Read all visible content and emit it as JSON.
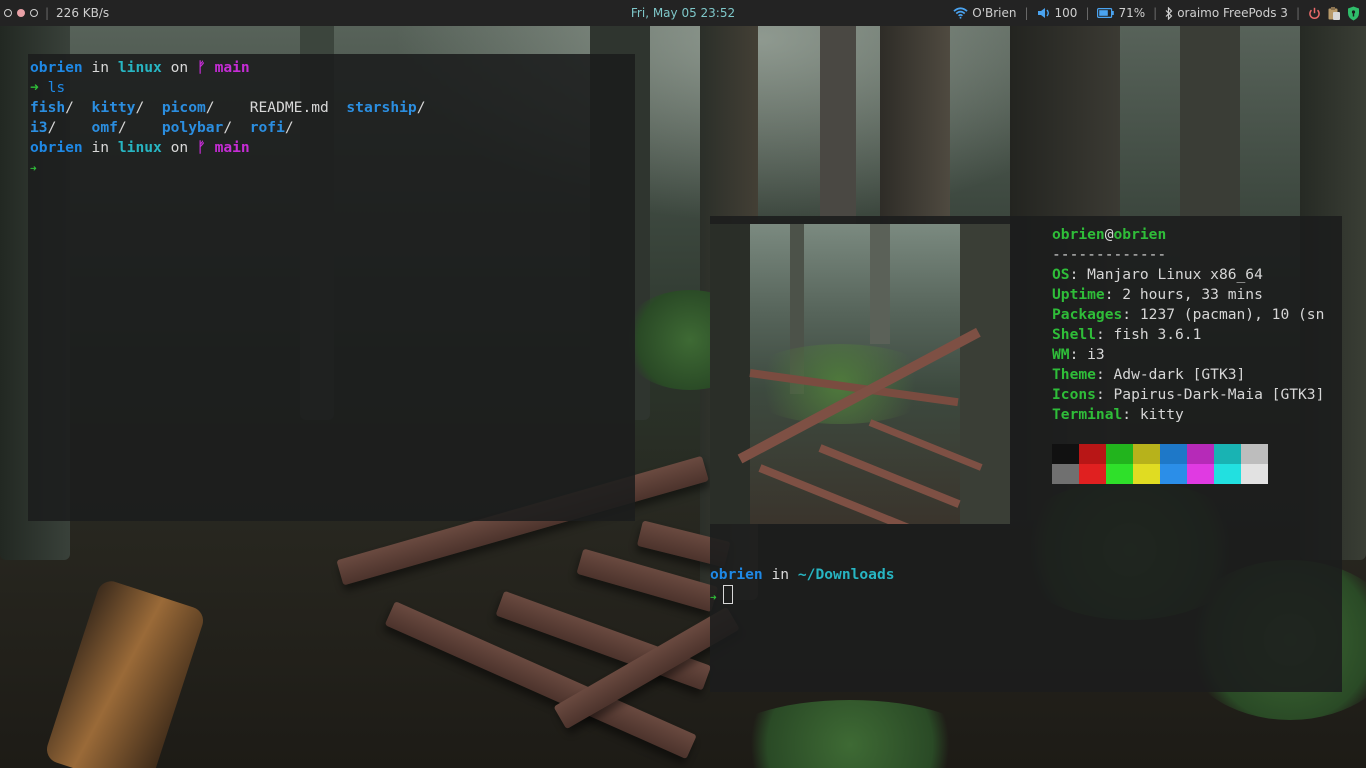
{
  "bar": {
    "net_speed": "226 KB/s",
    "datetime": "Fri, May 05 23:52",
    "wifi_name": "O'Brien",
    "volume": "100",
    "battery": "71%",
    "bluetooth_device": "oraimo FreePods 3",
    "icons": [
      "wifi-icon",
      "volume-icon",
      "battery-icon",
      "bluetooth-icon",
      "power-icon",
      "clipboard-icon",
      "shield-icon"
    ]
  },
  "term1": {
    "user": "obrien",
    "in": "in",
    "dir": "linux",
    "on": "on",
    "branch_symbol": "ᚠ",
    "branch": "main",
    "arrow": "➜",
    "command": "ls",
    "ls_row1": [
      "fish",
      "kitty",
      "picom",
      "README.md",
      "starship"
    ],
    "ls_row2": [
      "i3",
      "omf",
      "polybar",
      "rofi"
    ],
    "slash": "/"
  },
  "term2": {
    "user": "obrien",
    "at": "@",
    "host": "obrien",
    "rule": "-------------",
    "info": [
      {
        "key": "OS",
        "value": ": Manjaro Linux x86_64"
      },
      {
        "key": "Uptime",
        "value": ": 2 hours, 33 mins"
      },
      {
        "key": "Packages",
        "value": ": 1237 (pacman), 10 (sn"
      },
      {
        "key": "Shell",
        "value": ": fish 3.6.1"
      },
      {
        "key": "WM",
        "value": ": i3"
      },
      {
        "key": "Theme",
        "value": ": Adw-dark [GTK3]"
      },
      {
        "key": "Icons",
        "value": ": Papirus-Dark-Maia [GTK3]"
      },
      {
        "key": "Terminal",
        "value": ": kitty"
      }
    ],
    "palette": [
      "#111111",
      "#b81616",
      "#22b41d",
      "#b7b21b",
      "#1e78c8",
      "#b62ab8",
      "#19b3b3",
      "#bdbdbd",
      "#707070",
      "#e02020",
      "#2fe02a",
      "#e0dc22",
      "#2b8ee8",
      "#e03ae2",
      "#22e0e0",
      "#e2e2e2"
    ],
    "prompt_user": "obrien",
    "prompt_in": "in",
    "prompt_dir": "~/Downloads",
    "arrow": "➜"
  },
  "colors": {
    "bar_bg": "#232323",
    "date": "#7ec7c9",
    "user": "#1e88e5",
    "dir": "#27b5c2",
    "git": "#c62cd6",
    "arrow": "#2fbd39",
    "info_key": "#2fbd39"
  }
}
